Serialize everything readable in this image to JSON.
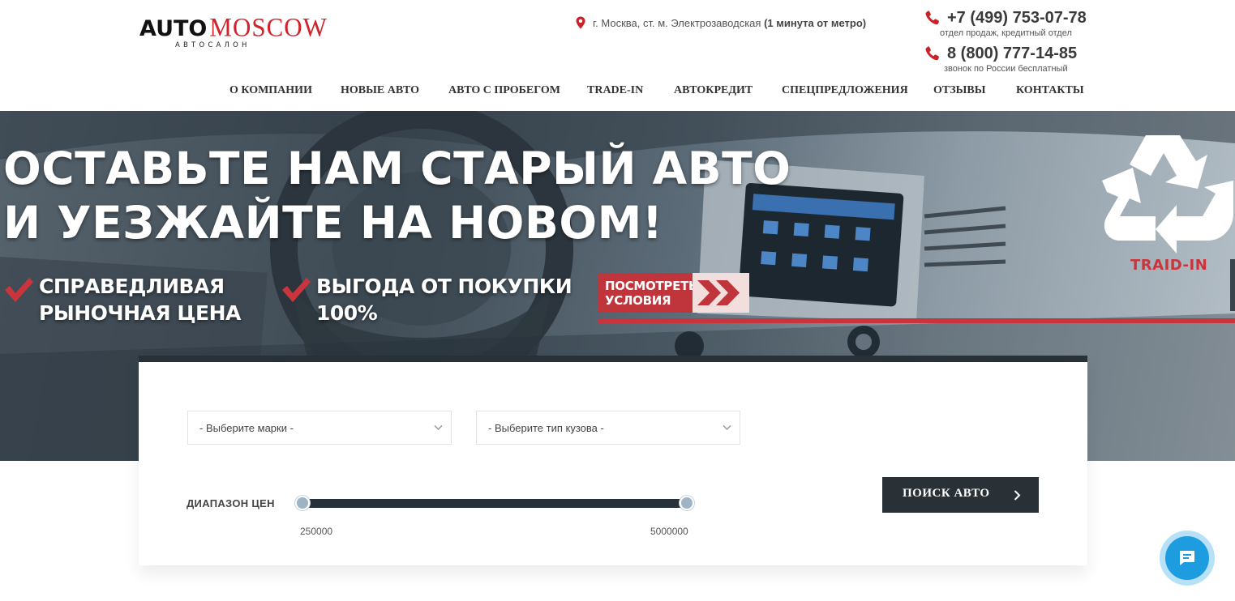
{
  "header": {
    "logo": {
      "auto": "AUTO",
      "moscow": "MOSCOW",
      "subtitle": "АВТОСАЛОН"
    },
    "address": {
      "text": "г. Москва, ст. м. Электрозаводская",
      "highlight": "(1 минута от метро)"
    },
    "phones": [
      {
        "number": "+7 (499) 753-07-78",
        "note": "отдел продаж, кредитный отдел"
      },
      {
        "number": "8 (800) 777-14-85",
        "note": "звонок по России бесплатный"
      }
    ]
  },
  "nav": {
    "items": [
      {
        "label": "О КОМПАНИИ"
      },
      {
        "label": "НОВЫЕ АВТО"
      },
      {
        "label": "АВТО С ПРОБЕГОМ"
      },
      {
        "label": "TRADE-IN"
      },
      {
        "label": "АВТОКРЕДИТ"
      },
      {
        "label": "СПЕЦПРЕДЛОЖЕНИЯ"
      },
      {
        "label": "ОТЗЫВЫ"
      },
      {
        "label": "КОНТАКТЫ"
      }
    ]
  },
  "hero": {
    "title_line1": "ОСТАВЬТЕ НАМ СТАРЫЙ АВТО",
    "title_line2": "И УЕЗЖАЙТЕ НА НОВОМ!",
    "benefits": [
      {
        "line1": "СПРАВЕДЛИВАЯ",
        "line2": "РЫНОЧНАЯ ЦЕНА"
      },
      {
        "line1": "ВЫГОДА ОТ ПОКУПКИ",
        "line2": "100%"
      }
    ],
    "cta": {
      "line1": "ПОСМОТРЕТЬ",
      "line2": "УСЛОВИЯ"
    },
    "badge_label": "TRAID-IN",
    "icons": {
      "check": "check-icon",
      "badge": "recycle-icon",
      "cta": "double-chevron-icon"
    }
  },
  "search": {
    "brand_select": {
      "value": "- Выберите марки -"
    },
    "body_select": {
      "value": "- Выберите тип кузова -"
    },
    "price_range": {
      "label": "ДИАПАЗОН ЦЕН",
      "min": "250000",
      "max": "5000000"
    },
    "button_label": "ПОИСК АВТО"
  },
  "chat": {
    "icon": "chat-icon"
  },
  "colors": {
    "brand_red": "#d1232a",
    "cta_red": "#c0353c",
    "dark": "#2a3136",
    "chat_blue": "#1d9de0"
  }
}
